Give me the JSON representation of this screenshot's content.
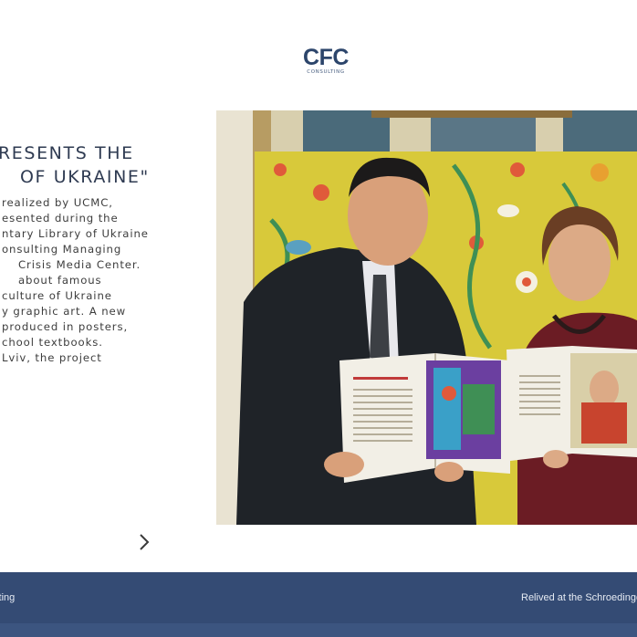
{
  "header": {
    "logo_text": "CFC",
    "logo_subtext": "CONSULTING"
  },
  "article": {
    "title_lines": [
      "RESENTS THE",
      "OF UKRAINE\""
    ],
    "body_lines": [
      "realized by UCMC,",
      "esented during the",
      "ntary Library of Ukraine",
      "onsulting Managing",
      "Crisis Media Center.",
      "about famous",
      "culture of Ukraine",
      "y graphic art. A new",
      "produced in posters,",
      "chool textbooks.",
      "Lviv, the project"
    ]
  },
  "carousel": {
    "next_icon": "chevron-right-icon"
  },
  "footer": {
    "left_text": "ulting",
    "right_text": "Relived at the Schroedinger's"
  },
  "colors": {
    "brand": "#2c456b",
    "footer_bg": "#344b74",
    "footer_strip": "#3c5580"
  }
}
